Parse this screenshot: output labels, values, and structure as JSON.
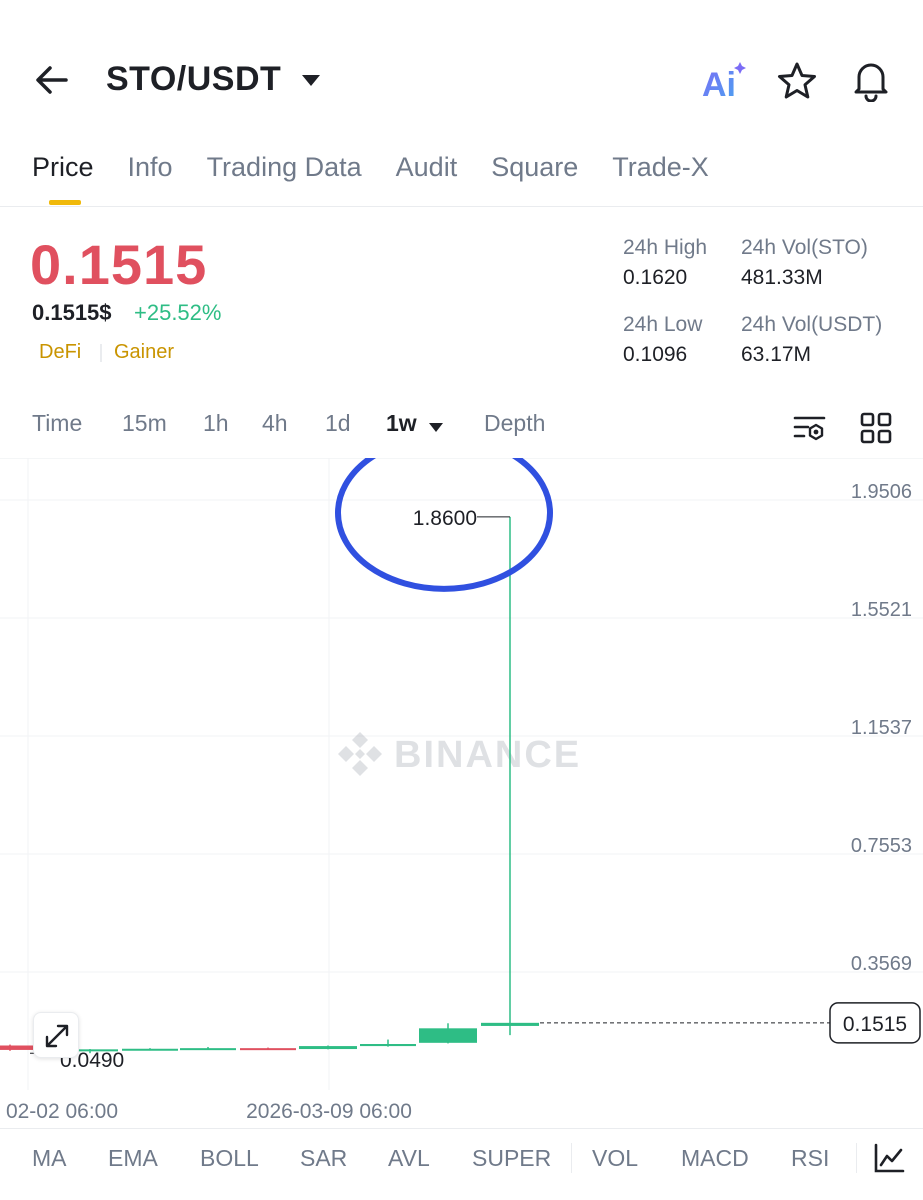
{
  "header": {
    "pair": "STO/USDT",
    "ai_label": "Ai"
  },
  "tabs": [
    {
      "label": "Price",
      "active": true
    },
    {
      "label": "Info"
    },
    {
      "label": "Trading Data"
    },
    {
      "label": "Audit"
    },
    {
      "label": "Square"
    },
    {
      "label": "Trade-X"
    }
  ],
  "price": {
    "last": "0.1515",
    "usd": "0.1515$",
    "change": "+25.52%",
    "tags": [
      "DeFi",
      "Gainer"
    ],
    "colors": {
      "down": "#e0505f",
      "up": "#2ebd85",
      "tag": "#c99400"
    }
  },
  "stats": {
    "high_label": "24h High",
    "high": "0.1620",
    "vol_sto_label": "24h Vol(STO)",
    "vol_sto": "481.33M",
    "low_label": "24h Low",
    "low": "0.1096",
    "vol_usdt_label": "24h Vol(USDT)",
    "vol_usdt": "63.17M"
  },
  "intervals": [
    "Time",
    "15m",
    "1h",
    "4h",
    "1d",
    "1w",
    "Depth"
  ],
  "active_interval": "1w",
  "chart_data": {
    "type": "candlestick",
    "watermark": "BINANCE",
    "y_ticks": [
      "1.9506",
      "1.5521",
      "1.1537",
      "0.7553",
      "0.3569"
    ],
    "ylim": [
      0,
      2.05
    ],
    "x_ticks": [
      "02-02 06:00",
      "2026-03-09 06:00"
    ],
    "high_marker": "1.8600",
    "low_marker": "0.0490",
    "current_price": "0.1515",
    "highlight": "circle around 1.8600 high",
    "candles": [
      {
        "open": 0.075,
        "close": 0.06,
        "high": 0.078,
        "low": 0.057,
        "dir": "down"
      },
      {
        "open": 0.06,
        "close": 0.062,
        "high": 0.063,
        "low": 0.049,
        "dir": "up"
      },
      {
        "open": 0.062,
        "close": 0.064,
        "high": 0.066,
        "low": 0.058,
        "dir": "up"
      },
      {
        "open": 0.064,
        "close": 0.066,
        "high": 0.07,
        "low": 0.06,
        "dir": "up"
      },
      {
        "open": 0.066,
        "close": 0.063,
        "high": 0.068,
        "low": 0.061,
        "dir": "down"
      },
      {
        "open": 0.063,
        "close": 0.073,
        "high": 0.075,
        "low": 0.062,
        "dir": "up"
      },
      {
        "open": 0.073,
        "close": 0.08,
        "high": 0.095,
        "low": 0.071,
        "dir": "up"
      },
      {
        "open": 0.084,
        "close": 0.133,
        "high": 0.15,
        "low": 0.082,
        "dir": "up"
      },
      {
        "open": 0.141,
        "close": 0.1515,
        "high": 1.86,
        "low": 0.11,
        "dir": "up"
      }
    ]
  },
  "indicators": [
    "MA",
    "EMA",
    "BOLL",
    "SAR",
    "AVL",
    "SUPER",
    "VOL",
    "MACD",
    "RSI"
  ]
}
